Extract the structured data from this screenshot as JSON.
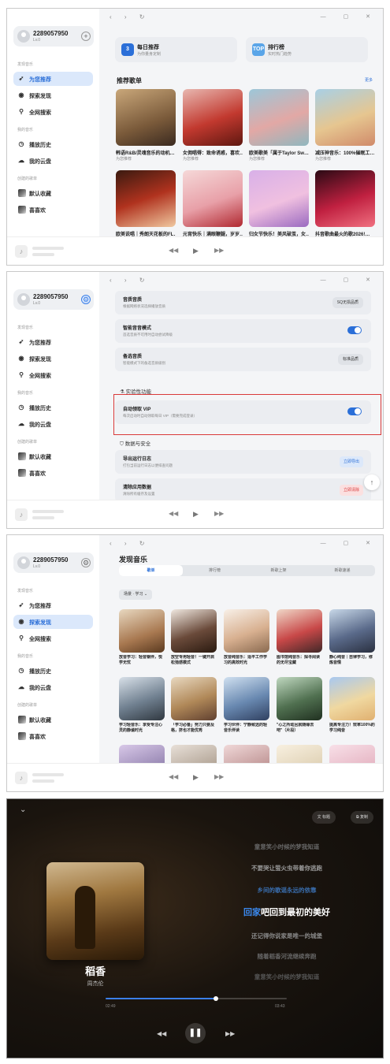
{
  "panels": {
    "sidebar": {
      "username": "2289057950",
      "level": "Lv.0",
      "sections": {
        "music": "发现音乐",
        "library": "我的音乐",
        "playlists": "创建的歌单"
      },
      "nav": {
        "recommend": "为您推荐",
        "explore": "探索发现",
        "search": "全网搜索",
        "history": "播放历史",
        "cloud": "我的云盘",
        "favorites": "默认收藏",
        "liked": "喜喜欢"
      }
    },
    "p1": {
      "daily": {
        "badge": "3",
        "title": "每日推荐",
        "sub": "为你量身定制"
      },
      "chart": {
        "badge": "TOP",
        "title": "排行榜",
        "sub": "实时热门趋势"
      },
      "section_title": "推荐歌单",
      "more": "更多",
      "playlists": [
        {
          "title": "韩语R&B/灵魂音乐的动机…",
          "sub": "为您推荐"
        },
        {
          "title": "女佣唱得：致命诱惑，喜欢…",
          "sub": "为您推荐"
        },
        {
          "title": "欧美歌美「属于Taylor Sw…",
          "sub": "为您推荐"
        },
        {
          "title": "减压神音乐：100%催眠工…",
          "sub": "为您推荐"
        },
        {
          "title": "欧美说唱｜秀朗天花板的FL…",
          "sub": ""
        },
        {
          "title": "元宵快乐｜满眼鞭腿，岁岁…",
          "sub": ""
        },
        {
          "title": "归女节快乐！美风破茧，女…",
          "sub": ""
        },
        {
          "title": "抖音歌曲最火的歌2026!…",
          "sub": ""
        }
      ]
    },
    "p2": {
      "rows": [
        {
          "title": "音质音质",
          "sub": "根据网络状况选择播放音质",
          "control": "SQ无损品质"
        },
        {
          "title": "智能音音模式",
          "sub": "首选音质不可用时自动尝试降级",
          "control": "toggle"
        },
        {
          "title": "备选音质",
          "sub": "智能模式下的备选音质级别",
          "control": "标准品质"
        }
      ],
      "experimental": "实验性功能",
      "vip": {
        "title": "自动领取 VIP",
        "sub": "每次启动时自动领取每日 VIP（需要完成登录）"
      },
      "data_section": "数据与安全",
      "export": {
        "title": "导出运行日志",
        "sub": "打包当前运行日志以便排查问题",
        "button": "立即导出"
      },
      "clear": {
        "title": "清除应用数据",
        "sub": "清除所有缓存及设置",
        "button": "立即清除"
      }
    },
    "p3": {
      "title": "发现音乐",
      "tabs": [
        "歌单",
        "排行榜",
        "新歌上架",
        "新歌速递"
      ],
      "filter": "场景 · 学习",
      "items": [
        {
          "title": "放音学习：轻音钢伴，悦学无忧"
        },
        {
          "title": "放空专用轻音！一键开启松弛感模式"
        },
        {
          "title": "放音纯音乐：适平工作学习的高效时光"
        },
        {
          "title": "图书馆纯音乐：探寻阅读的无尽宝藏"
        },
        {
          "title": "静心纯音｜自律学习，修炼音情"
        },
        {
          "title": "学习轻音乐：享受专注心灵的静谧时光"
        },
        {
          "title": "「学习必备」努力只要及格，挤也才能优秀"
        },
        {
          "title": "学习伙伴：宁静致远的轻音乐伴读"
        },
        {
          "title": "\"心之所动且就随缘去吧\"（片段）"
        },
        {
          "title": "提高专注力！效率100%的学习纯音"
        }
      ]
    },
    "p4": {
      "song": "稻香",
      "artist": "周杰伦",
      "actions": {
        "translate": "标题",
        "copy": "复制"
      },
      "lyrics": [
        "童意笑小时候的梦我知道",
        "不要哭让萤火虫带着你逃跑",
        "乡间的歌谣永远的依靠",
        "回家吧回到最初的美好",
        "还记得你说家是唯一的城堡",
        "随着稻香河流继续奔跑",
        "童意笑小时候的梦我知道"
      ],
      "time_current": "02:49",
      "time_total": "03:43",
      "progress": 0.61
    }
  },
  "colors": {
    "accent": "#2b6fd8",
    "red_box": "#d93a3a"
  }
}
